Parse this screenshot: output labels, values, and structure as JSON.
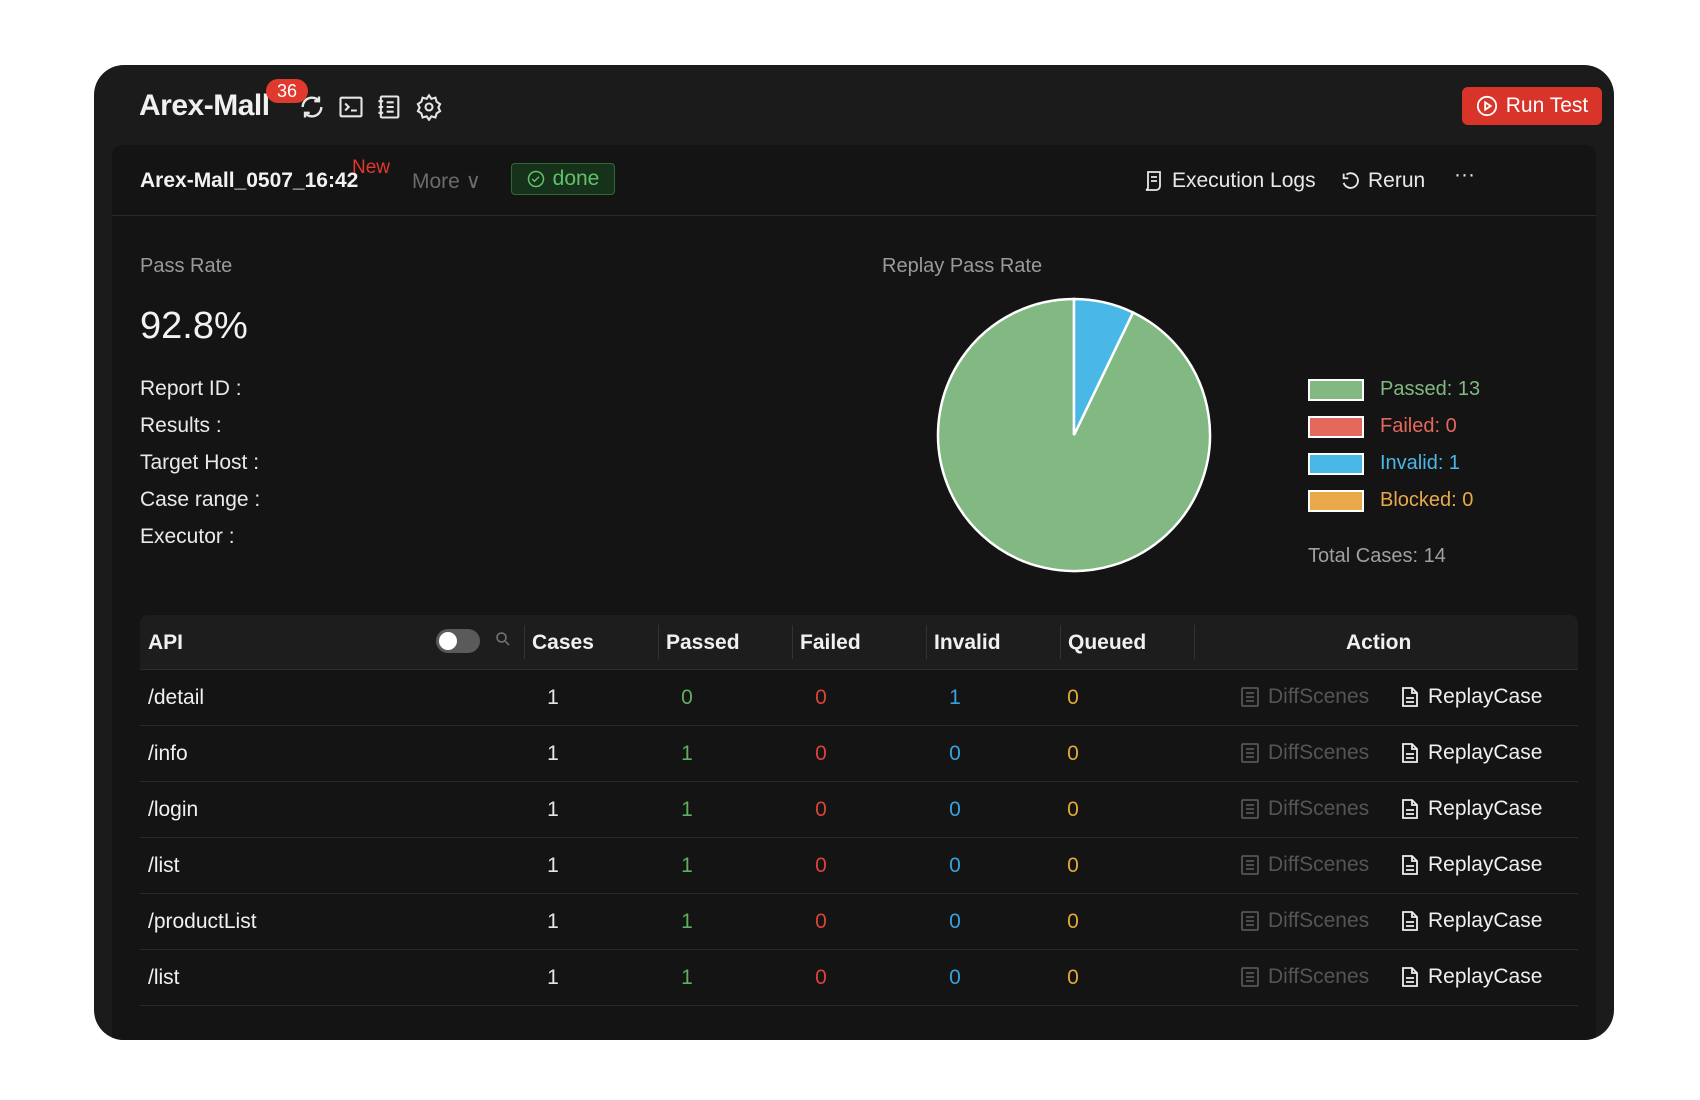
{
  "app": {
    "title": "Arex-Mall",
    "badge_count": "36",
    "run_button": "Run Test",
    "accent": "#d9342a"
  },
  "report": {
    "name": "Arex-Mall_0507_16:42",
    "new_tag": "New",
    "more": "More ∨",
    "status": "done",
    "execution_logs": "Execution Logs",
    "rerun": "Rerun",
    "overflow": "···"
  },
  "summary": {
    "pass_rate_label": "Pass Rate",
    "pass_rate_value": "92.8%",
    "meta": [
      "Report ID :",
      "Results :",
      "Target Host :",
      "Case range :",
      "Executor :"
    ]
  },
  "chart_data": {
    "type": "pie",
    "title": "Replay Pass Rate",
    "categories": [
      "Passed",
      "Failed",
      "Invalid",
      "Blocked"
    ],
    "values": [
      13,
      0,
      1,
      0
    ],
    "colors": [
      "#82b882",
      "#e5685c",
      "#4ab8e6",
      "#e9a94a"
    ],
    "legend": [
      "Passed: 13",
      "Failed: 0",
      "Invalid: 1",
      "Blocked: 0"
    ],
    "legend_placement": "right",
    "total_label": "Total Cases: 14"
  },
  "table": {
    "headers": {
      "api": "API",
      "cases": "Cases",
      "passed": "Passed",
      "failed": "Failed",
      "invalid": "Invalid",
      "queued": "Queued",
      "action": "Action"
    },
    "diff_label": "DiffScenes",
    "replay_label": "ReplayCase",
    "rows": [
      {
        "api": "/detail",
        "cases": "1",
        "passed": "0",
        "failed": "0",
        "invalid": "1",
        "queued": "0"
      },
      {
        "api": "/info",
        "cases": "1",
        "passed": "1",
        "failed": "0",
        "invalid": "0",
        "queued": "0"
      },
      {
        "api": "/login",
        "cases": "1",
        "passed": "1",
        "failed": "0",
        "invalid": "0",
        "queued": "0"
      },
      {
        "api": "/list",
        "cases": "1",
        "passed": "1",
        "failed": "0",
        "invalid": "0",
        "queued": "0"
      },
      {
        "api": "/productList",
        "cases": "1",
        "passed": "1",
        "failed": "0",
        "invalid": "0",
        "queued": "0"
      },
      {
        "api": "/list",
        "cases": "1",
        "passed": "1",
        "failed": "0",
        "invalid": "0",
        "queued": "0"
      }
    ]
  }
}
